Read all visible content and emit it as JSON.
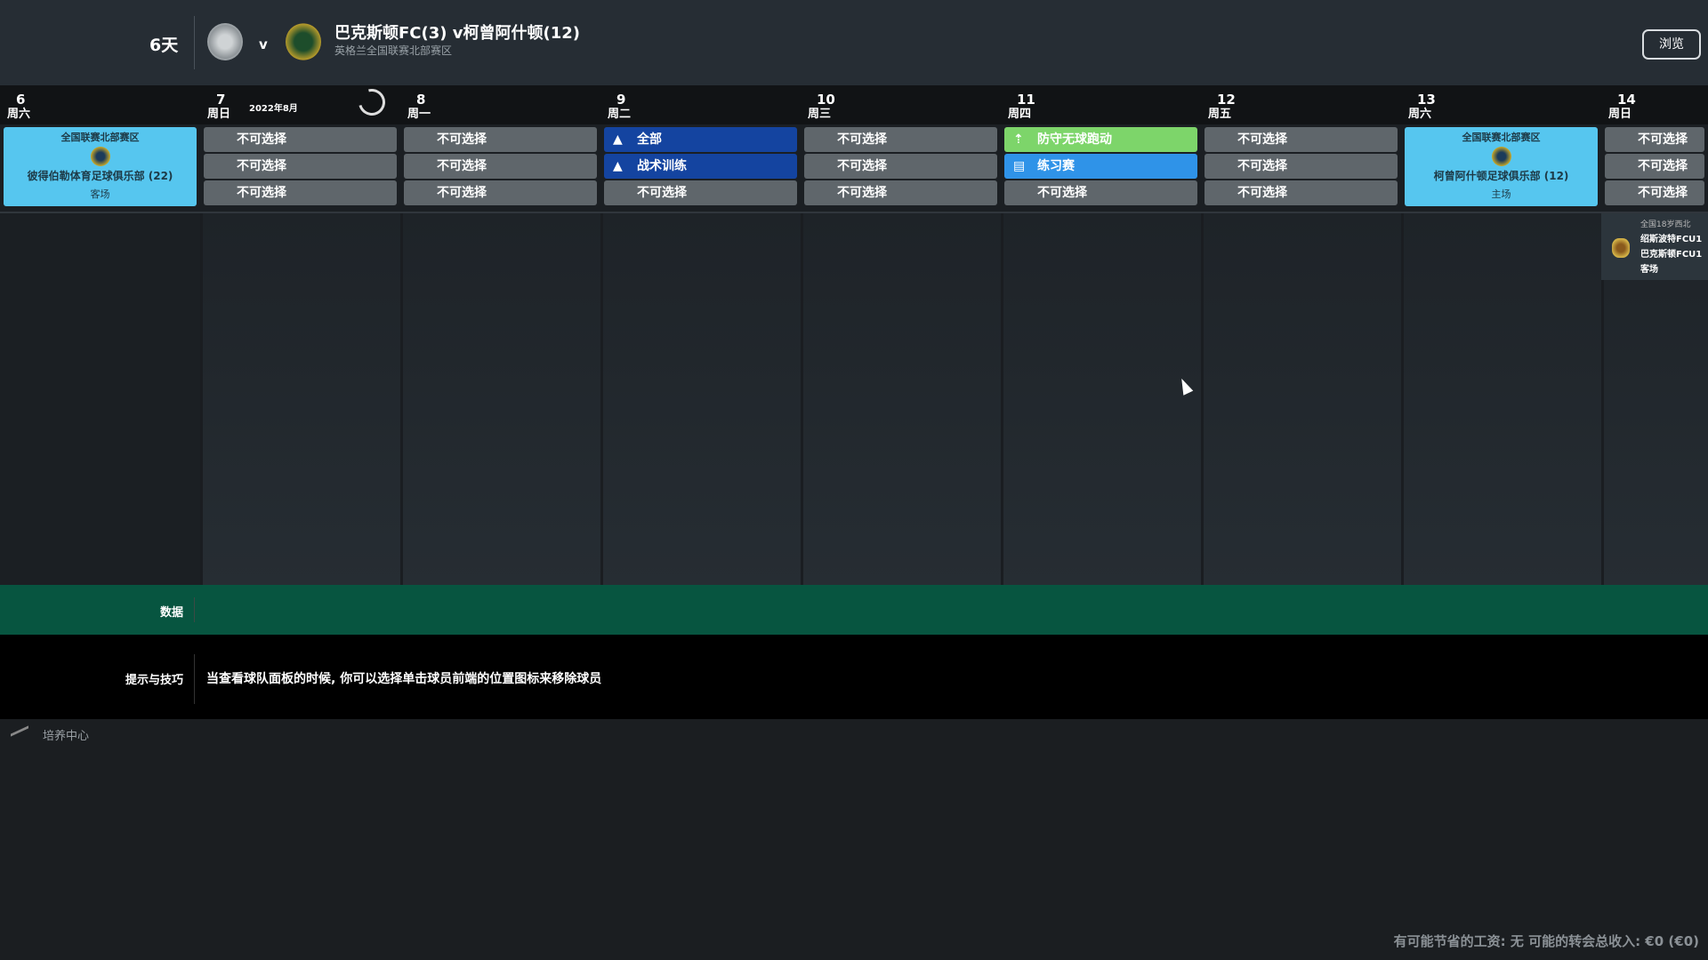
{
  "header": {
    "days_until": "6天",
    "vs": "v",
    "match_title": "巴克斯顿FC(3) v柯曾阿什顿(12)",
    "competition": "英格兰全国联赛北部赛区",
    "browse_label": "浏览"
  },
  "calendar": {
    "month_label": "2022年8月",
    "days": [
      {
        "num": "6",
        "weekday": "周六",
        "match": {
          "competition": "全国联赛北部赛区",
          "opponent": "彼得伯勒体育足球俱乐部 (22)",
          "venue": "客场"
        }
      },
      {
        "num": "7",
        "weekday": "周日",
        "slots": [
          {
            "label": "不可选择",
            "type": "unavailable"
          },
          {
            "label": "不可选择",
            "type": "unavailable"
          },
          {
            "label": "不可选择",
            "type": "unavailable"
          }
        ]
      },
      {
        "num": "8",
        "weekday": "周一",
        "slots": [
          {
            "label": "不可选择",
            "type": "unavailable"
          },
          {
            "label": "不可选择",
            "type": "unavailable"
          },
          {
            "label": "不可选择",
            "type": "unavailable"
          }
        ]
      },
      {
        "num": "9",
        "weekday": "周二",
        "slots": [
          {
            "label": "全部",
            "type": "training",
            "icon": "cone-icon"
          },
          {
            "label": "战术训练",
            "type": "training",
            "icon": "cone-icon"
          },
          {
            "label": "不可选择",
            "type": "unavailable"
          }
        ]
      },
      {
        "num": "10",
        "weekday": "周三",
        "slots": [
          {
            "label": "不可选择",
            "type": "unavailable"
          },
          {
            "label": "不可选择",
            "type": "unavailable"
          },
          {
            "label": "不可选择",
            "type": "unavailable"
          }
        ]
      },
      {
        "num": "11",
        "weekday": "周四",
        "slots": [
          {
            "label": "防守无球跑动",
            "type": "movement",
            "icon": "movement-icon"
          },
          {
            "label": "练习赛",
            "type": "friendly",
            "icon": "clipboard-icon"
          },
          {
            "label": "不可选择",
            "type": "unavailable"
          }
        ]
      },
      {
        "num": "12",
        "weekday": "周五",
        "slots": [
          {
            "label": "不可选择",
            "type": "unavailable"
          },
          {
            "label": "不可选择",
            "type": "unavailable"
          },
          {
            "label": "不可选择",
            "type": "unavailable"
          }
        ]
      },
      {
        "num": "13",
        "weekday": "周六",
        "match": {
          "competition": "全国联赛北部赛区",
          "opponent": "柯曾阿什顿足球俱乐部 (12)",
          "venue": "主场"
        }
      },
      {
        "num": "14",
        "weekday": "周日",
        "slots": [
          {
            "label": "不可选择",
            "type": "unavailable"
          },
          {
            "label": "不可选择",
            "type": "unavailable"
          },
          {
            "label": "不可选择",
            "type": "unavailable"
          }
        ]
      }
    ],
    "side_fixture": {
      "competition": "全国18岁西北",
      "home": "绍斯波特FCU1",
      "away": "巴克斯顿FCU1",
      "venue": "客场"
    }
  },
  "colors": {
    "unavailable": "#5f666b",
    "training": "#1444a0",
    "movement": "#7dd56a",
    "friendly": "#2f93e8",
    "match": "#56c6ef",
    "data_bar": "#075540"
  },
  "data_bar": {
    "label": "数据"
  },
  "tips": {
    "label": "提示与技巧",
    "text": "当查看球队面板的时候, 你可以选择单击球员前端的位置图标来移除球员"
  },
  "bottom": {
    "label": "培养中心"
  },
  "footer": {
    "text": "有可能节省的工资: 无 可能的转会总收入: €0 (€0)"
  }
}
